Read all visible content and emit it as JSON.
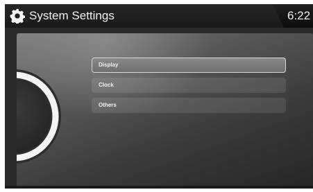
{
  "header": {
    "title": "System Settings",
    "clock": "6:22",
    "icon": "gear-icon"
  },
  "menu": {
    "items": [
      {
        "label": "Display",
        "selected": true
      },
      {
        "label": "Clock",
        "selected": false
      },
      {
        "label": "Others",
        "selected": false
      }
    ]
  },
  "colors": {
    "background": "#2a2a2a",
    "header": "#1e1e1e",
    "text": "#f2f2f2",
    "selected_border": "#d8d8d8"
  }
}
